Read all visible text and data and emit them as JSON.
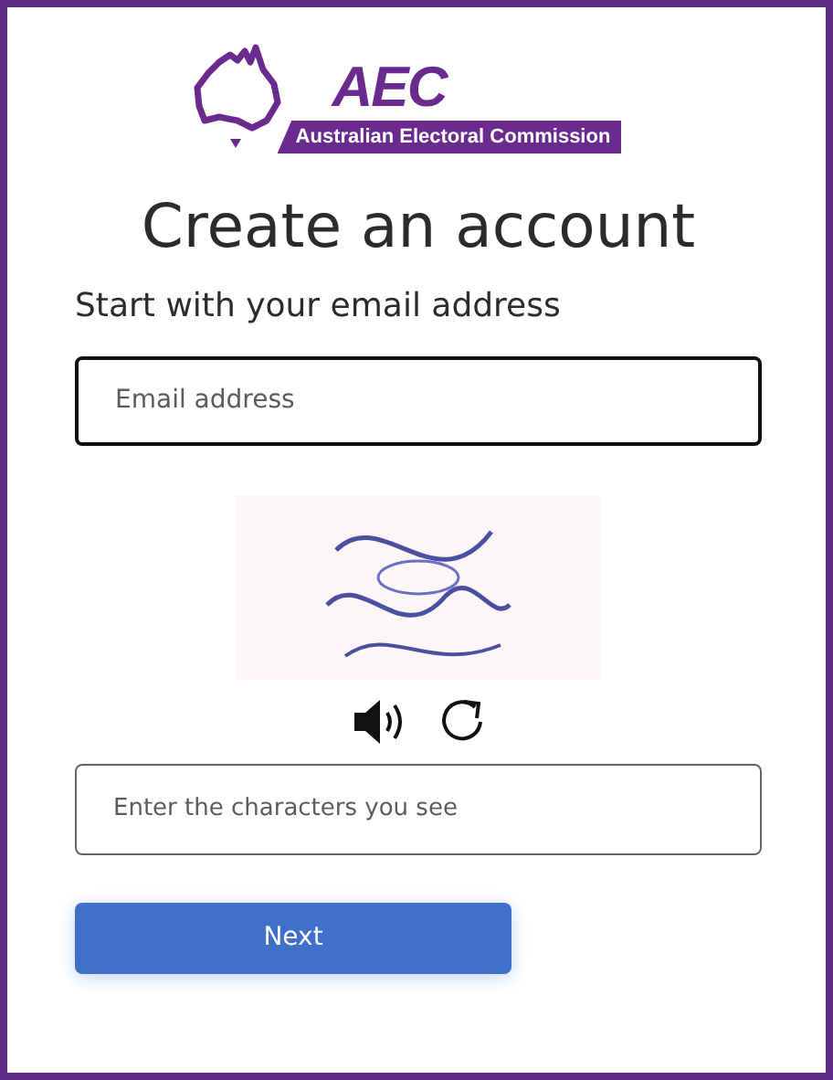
{
  "logo": {
    "acronym": "AEC",
    "name": "Australian Electoral Commission"
  },
  "title": "Create an account",
  "subtitle": "Start with your email address",
  "email_field": {
    "placeholder": "Email address",
    "focused": true
  },
  "captcha_field": {
    "placeholder": "Enter the characters you see"
  },
  "next_button": {
    "label": "Next"
  }
}
